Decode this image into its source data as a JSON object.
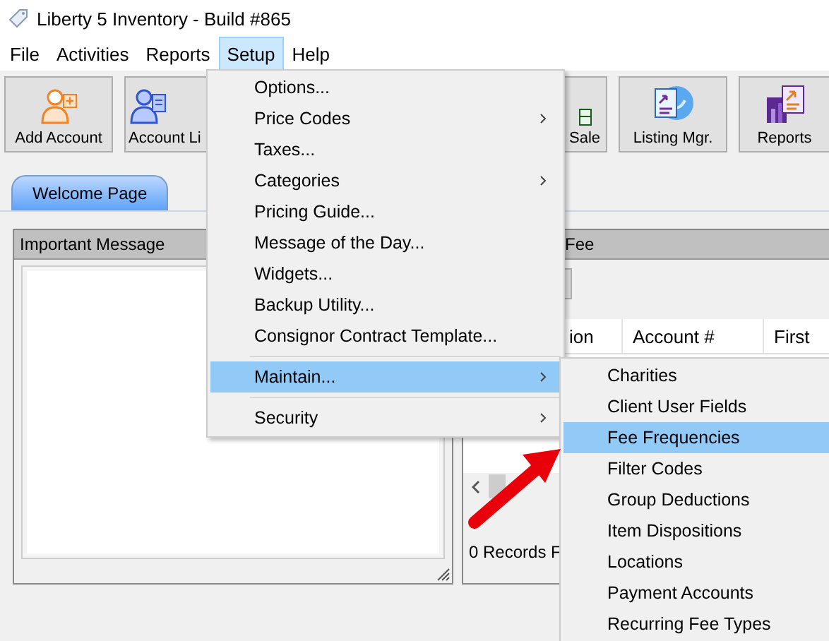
{
  "window": {
    "title": "Liberty 5 Inventory - Build #865"
  },
  "menu_bar": [
    {
      "label": "File",
      "selected": false
    },
    {
      "label": "Activities",
      "selected": false
    },
    {
      "label": "Reports",
      "selected": false
    },
    {
      "label": "Setup",
      "selected": true
    },
    {
      "label": "Help",
      "selected": false
    }
  ],
  "toolbar": [
    {
      "label": "Add Account",
      "kind": "add-account"
    },
    {
      "label": "Account Li",
      "kind": "account-list"
    },
    {
      "label": "Sale",
      "kind": "sale"
    },
    {
      "label": "Listing Mgr.",
      "kind": "listing"
    },
    {
      "label": "Reports",
      "kind": "reports"
    }
  ],
  "tabs": [
    {
      "label": "Welcome Page",
      "selected": true
    }
  ],
  "important_message": {
    "title": "Important Message"
  },
  "fee_panel": {
    "title": "Fee",
    "columns": [
      "ion",
      "Account #",
      "First"
    ],
    "status": "0 Records F"
  },
  "setup_menu": [
    {
      "kind": "item",
      "label": "Options...",
      "submenu": false,
      "selected": false
    },
    {
      "kind": "item",
      "label": "Price Codes",
      "submenu": true,
      "selected": false
    },
    {
      "kind": "item",
      "label": "Taxes...",
      "submenu": false,
      "selected": false
    },
    {
      "kind": "item",
      "label": "Categories",
      "submenu": true,
      "selected": false
    },
    {
      "kind": "item",
      "label": "Pricing Guide...",
      "submenu": false,
      "selected": false
    },
    {
      "kind": "item",
      "label": "Message of the Day...",
      "submenu": false,
      "selected": false
    },
    {
      "kind": "item",
      "label": "Widgets...",
      "submenu": false,
      "selected": false
    },
    {
      "kind": "item",
      "label": "Backup Utility...",
      "submenu": false,
      "selected": false
    },
    {
      "kind": "item",
      "label": "Consignor Contract Template...",
      "submenu": false,
      "selected": false
    },
    {
      "kind": "separator"
    },
    {
      "kind": "item",
      "label": "Maintain...",
      "submenu": true,
      "selected": true
    },
    {
      "kind": "separator"
    },
    {
      "kind": "item",
      "label": "Security",
      "submenu": true,
      "selected": false
    }
  ],
  "maintain_submenu": [
    {
      "label": "Charities",
      "selected": false
    },
    {
      "label": "Client User Fields",
      "selected": false
    },
    {
      "label": "Fee Frequencies",
      "selected": true
    },
    {
      "label": "Filter Codes",
      "selected": false
    },
    {
      "label": "Group Deductions",
      "selected": false
    },
    {
      "label": "Item Dispositions",
      "selected": false
    },
    {
      "label": "Locations",
      "selected": false
    },
    {
      "label": "Payment Accounts",
      "selected": false
    },
    {
      "label": "Recurring Fee Types",
      "selected": false
    }
  ]
}
